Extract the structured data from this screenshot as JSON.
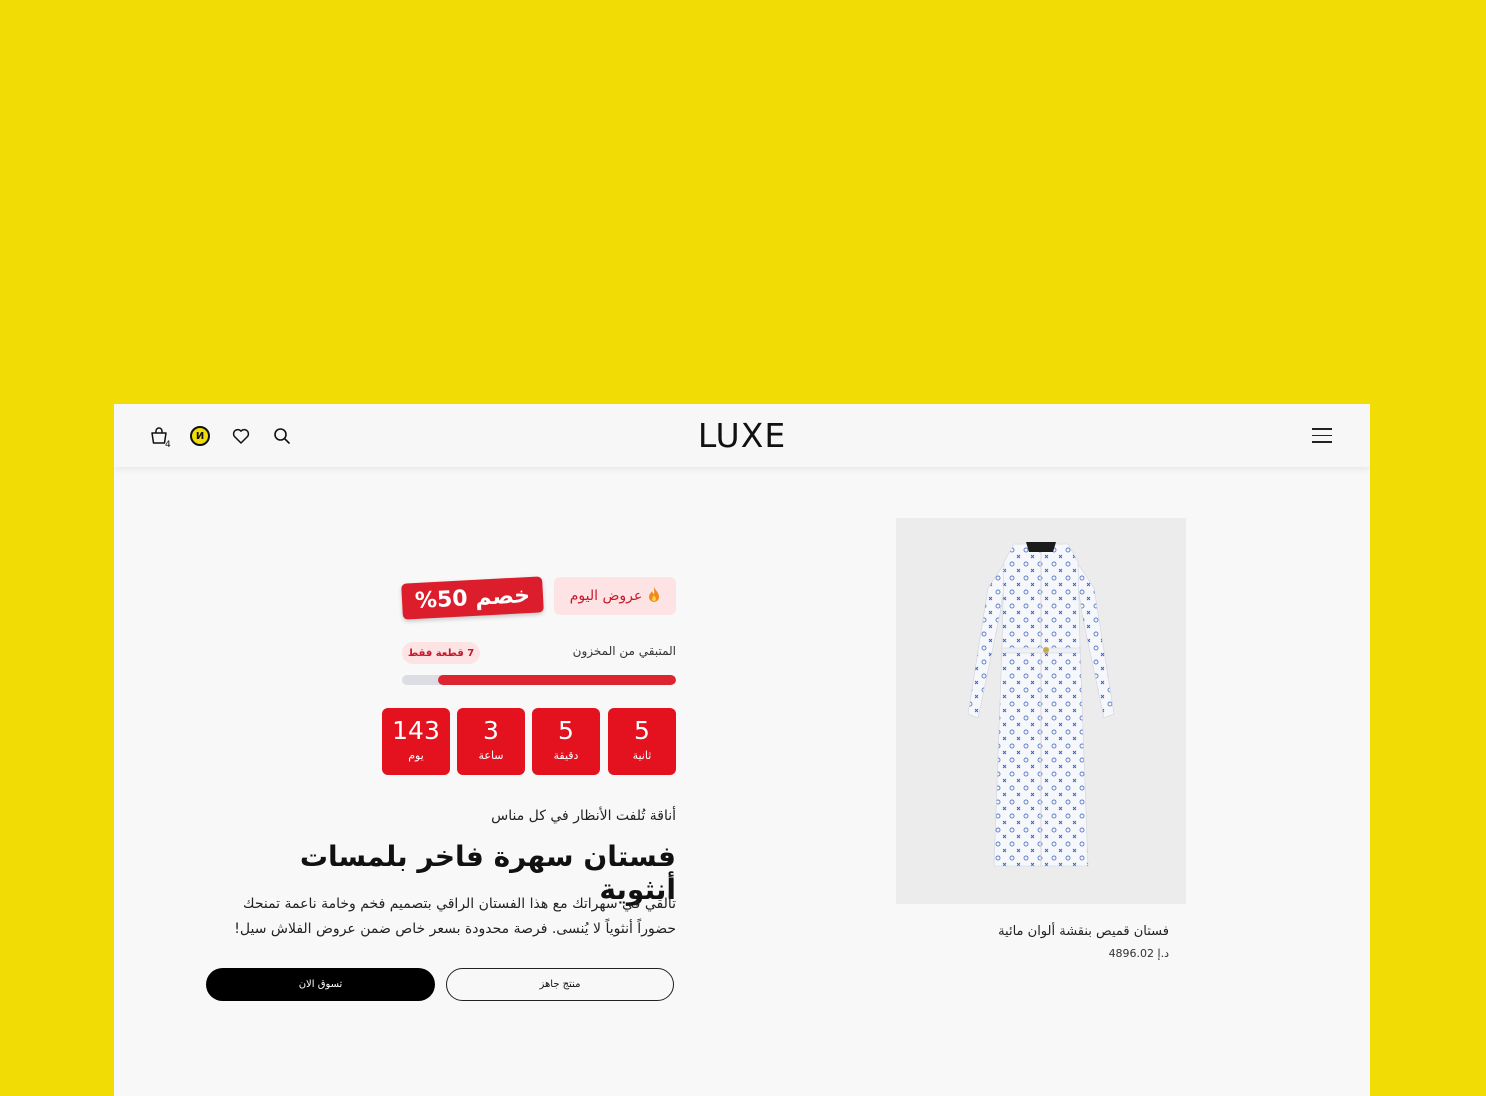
{
  "colors": {
    "background": "#f1dc06",
    "accent_red": "#e4121f",
    "badge_bg": "#fde3e4"
  },
  "header": {
    "logo": "LUXE",
    "cart_count": "4",
    "icons": [
      "cart-icon",
      "currency-badge-icon",
      "heart-icon",
      "search-icon",
      "menu-icon"
    ]
  },
  "product": {
    "title": "فستان قميص بنقشة ألوان مائية",
    "price": "4896.02 د.إ"
  },
  "promo": {
    "deal_label": "عروض اليوم",
    "discount_label": "خصم 50%",
    "stock_label": "المتبقي من المخزون",
    "stock_pill": "7 قطعة فقط",
    "stock_remaining_fraction": 0.87
  },
  "countdown": [
    {
      "value": "143",
      "unit": "يوم"
    },
    {
      "value": "3",
      "unit": "ساعة"
    },
    {
      "value": "5",
      "unit": "دقيقة"
    },
    {
      "value": "5",
      "unit": "ثانية"
    }
  ],
  "hero": {
    "tagline": "أناقة تُلفت الأنظار في كل مناس",
    "headline": "فستان سهرة فاخر بلمسات أنثوية",
    "description": "تألقي في سهراتك مع هذا الفستان الراقي بتصميم فخم وخامة ناعمة تمنحك حضوراً أنثوياً لا يُنسى. فرصة محدودة بسعر خاص ضمن عروض الفلاش سيل!",
    "primary_button": "تسوق الان",
    "secondary_button": "منتج جاهز"
  }
}
